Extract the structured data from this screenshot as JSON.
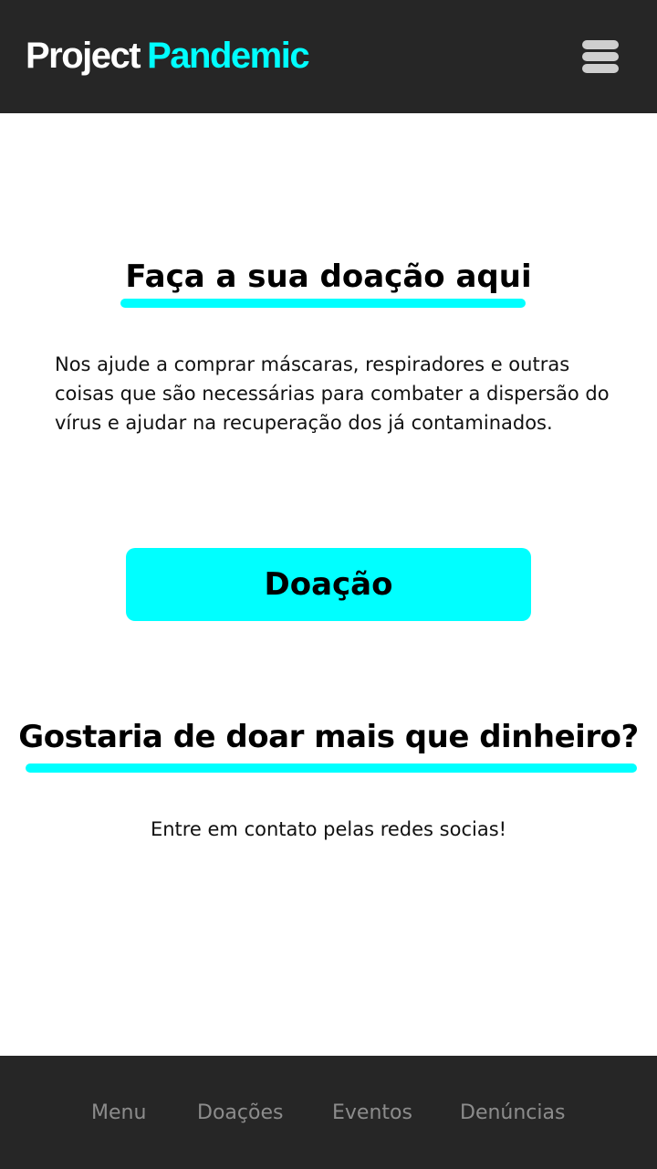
{
  "header": {
    "logo_part1": "Project",
    "logo_part2": "Pandemic",
    "menu_icon": "hamburger-menu-icon"
  },
  "main": {
    "donation_heading": "Faça a sua doação aqui",
    "donation_text": "Nos ajude a comprar máscaras, respiradores e outras coisas que são necessárias para combater a dispersão do vírus e ajudar na recuperação dos já contaminados.",
    "donate_button_label": "Doação",
    "more_heading": "Gostaria de doar mais que dinheiro?",
    "contact_text": "Entre em contato pelas redes socias!"
  },
  "footer": {
    "nav": [
      "Menu",
      "Doações",
      "Eventos",
      "Denúncias"
    ]
  },
  "colors": {
    "accent": "#00ffff",
    "header_bg": "#262626",
    "footer_link": "#8c8c8c"
  }
}
